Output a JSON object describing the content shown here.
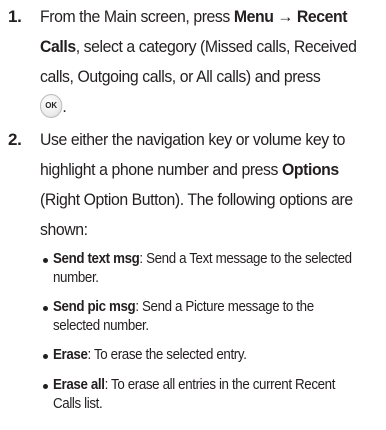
{
  "steps": [
    {
      "number": "1.",
      "intro": "From the Main screen, press ",
      "menu_bold": "Menu",
      "arrow": " → ",
      "recent_bold_1": "Recent",
      "recent_bold_2": "Calls",
      "mid": ", select a category (Missed calls, Received",
      "line3": "calls, Outgoing calls, or All calls) and press",
      "ok_label": "OK",
      "end": "."
    },
    {
      "number": "2.",
      "line1": "Use either the navigation key or volume key to",
      "line2_pre": "highlight a phone number and press ",
      "options_bold": "Options",
      "line3": "(Right Option Button). The following options are",
      "line4": "shown:"
    }
  ],
  "options": [
    {
      "term": "Send text msg",
      "desc_line1": ": Send a Text message to the selected",
      "desc_line2": "number."
    },
    {
      "term": "Send pic msg",
      "desc_line1": ": Send a Picture message to the",
      "desc_line2": "selected number."
    },
    {
      "term": "Erase",
      "desc_line1": ": To erase the selected entry.",
      "desc_line2": ""
    },
    {
      "term": "Erase all",
      "desc_line1": ": To erase all entries in the current Recent",
      "desc_line2": "Calls list."
    }
  ]
}
